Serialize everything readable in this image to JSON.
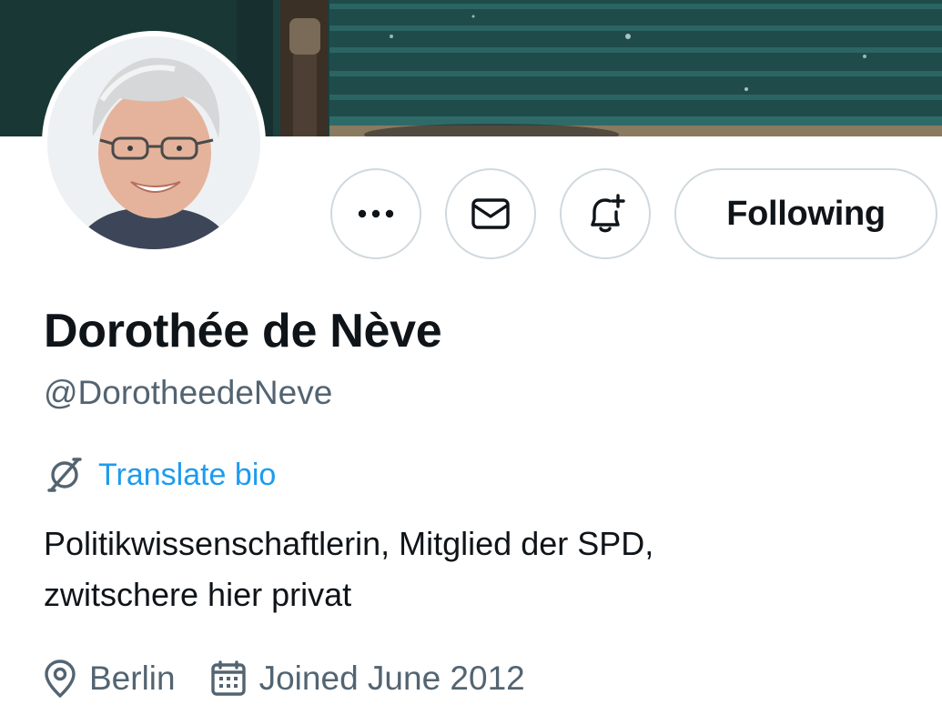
{
  "profile": {
    "display_name": "Dorothée de Nève",
    "handle": "@DorotheedeNeve",
    "bio_lines": [
      "Politikwissenschaftlerin, Mitglied der SPD,",
      "zwitschere hier privat"
    ],
    "location": "Berlin",
    "joined": "Joined June 2012"
  },
  "actions": {
    "more_icon": "more-horizontal-icon",
    "message_icon": "envelope-icon",
    "notify_icon": "bell-plus-icon",
    "follow_label": "Following"
  },
  "translate": {
    "icon": "translate-globe-icon",
    "label": "Translate bio"
  },
  "meta_icons": {
    "location": "map-pin-icon",
    "joined": "calendar-icon"
  },
  "colors": {
    "primary_text": "#0f1419",
    "secondary_text": "#536471",
    "link": "#1d9bf0",
    "border": "#cfd9de"
  }
}
